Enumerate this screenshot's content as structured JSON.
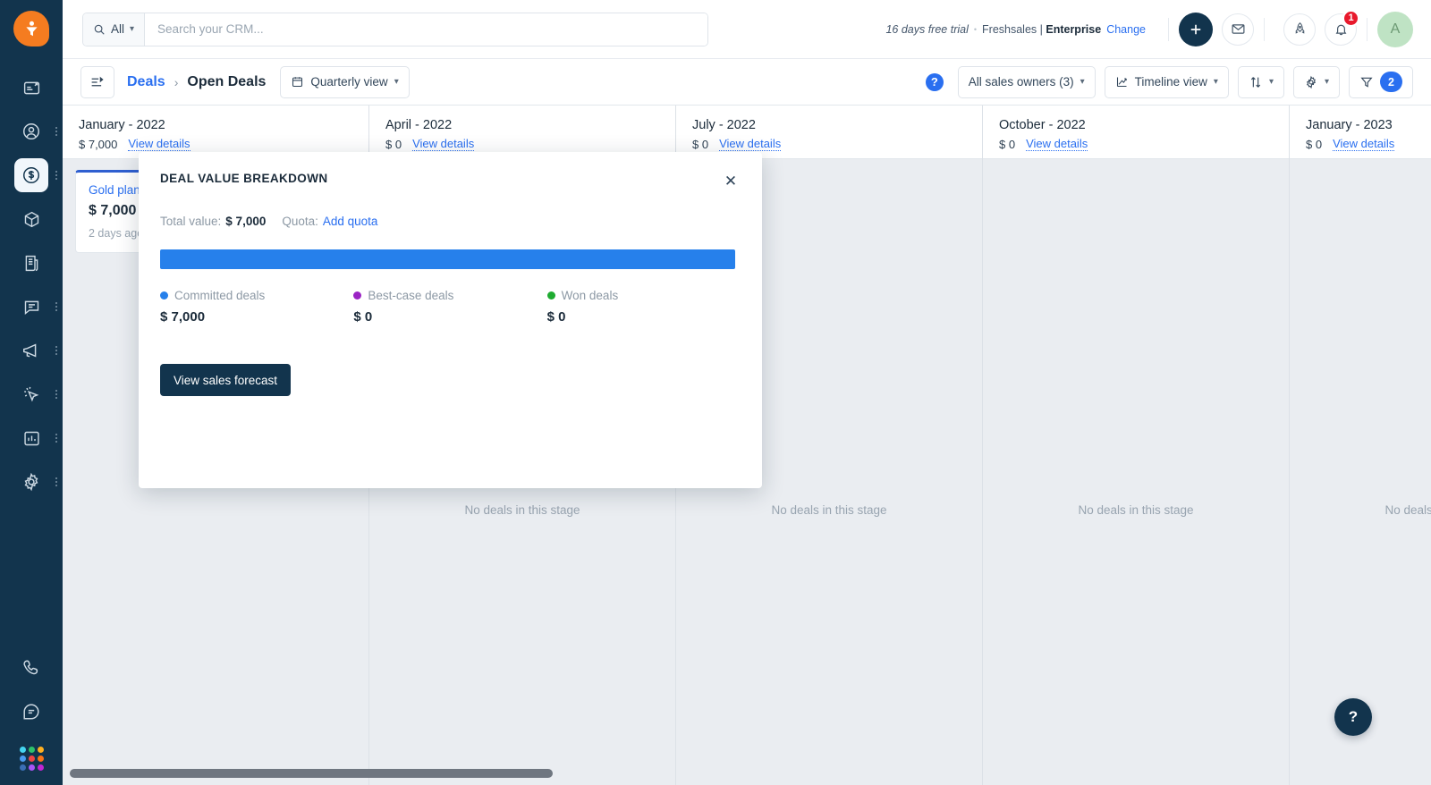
{
  "brand": {
    "logo_name": "freshsales-logo",
    "accent": "#f57c20"
  },
  "search": {
    "scope": "All",
    "placeholder": "Search your CRM...",
    "value": ""
  },
  "account": {
    "trial_days": "16 days free trial",
    "separator": "•",
    "product": "Freshsales | ",
    "plan": "Enterprise",
    "change_label": "Change",
    "notifications_count": "1",
    "avatar_initial": "A"
  },
  "toolbar": {
    "breadcrumb_parent": "Deals",
    "breadcrumb_sep": "›",
    "breadcrumb_current": "Open Deals",
    "period_view": "Quarterly view",
    "owners_filter": "All sales owners (3)",
    "display_view": "Timeline view",
    "filter_count": "2",
    "help_glyph": "?"
  },
  "board": {
    "columns": [
      {
        "title": "January - 2022",
        "amount": "$ 7,000",
        "details_label": "View details",
        "empty_label": "",
        "deals": [
          {
            "name": "Gold plan",
            "amount": "$ 7,000",
            "age": "2 days ago"
          }
        ]
      },
      {
        "title": "April - 2022",
        "amount": "$ 0",
        "details_label": "View details",
        "empty_label": "No deals in this stage",
        "deals": []
      },
      {
        "title": "July - 2022",
        "amount": "$ 0",
        "details_label": "View details",
        "empty_label": "No deals in this stage",
        "deals": []
      },
      {
        "title": "October - 2022",
        "amount": "$ 0",
        "details_label": "View details",
        "empty_label": "No deals in this stage",
        "deals": []
      },
      {
        "title": "January - 2023",
        "amount": "$ 0",
        "details_label": "View details",
        "empty_label": "No deals in this stage",
        "deals": []
      }
    ]
  },
  "modal": {
    "title": "DEAL VALUE BREAKDOWN",
    "close_glyph": "✕",
    "total_label": "Total value:",
    "total_value": "$ 7,000",
    "quota_label": "Quota:",
    "quota_link": "Add quota",
    "action_label": "View sales forecast",
    "chart_data": {
      "type": "bar",
      "title": "DEAL VALUE BREAKDOWN",
      "categories": [
        "Committed deals",
        "Best-case deals",
        "Won deals"
      ],
      "values": [
        7000,
        0,
        0
      ],
      "value_labels": [
        "$ 7,000",
        "$ 0",
        "$ 0"
      ],
      "colors": [
        "#2680eb",
        "#9b24c4",
        "#1fab31"
      ],
      "total": 7000,
      "total_label": "$ 7,000",
      "quota": null,
      "xlabel": "",
      "ylabel": "",
      "stacked": true,
      "orientation": "horizontal",
      "legend": "bottom",
      "grid": false
    }
  },
  "help_fab": {
    "glyph": "?"
  },
  "sidebar": {
    "items": [
      {
        "name": "dashboard",
        "has_menu": false
      },
      {
        "name": "contacts",
        "has_menu": true
      },
      {
        "name": "deals",
        "has_menu": true,
        "active": true
      },
      {
        "name": "products",
        "has_menu": false
      },
      {
        "name": "documents",
        "has_menu": false
      },
      {
        "name": "conversations",
        "has_menu": true
      },
      {
        "name": "campaigns",
        "has_menu": true
      },
      {
        "name": "automations",
        "has_menu": true
      },
      {
        "name": "reports",
        "has_menu": true
      },
      {
        "name": "settings",
        "has_menu": true
      }
    ],
    "bottom": [
      {
        "name": "phone"
      },
      {
        "name": "chat"
      }
    ],
    "app_switcher_colors": [
      "#45d4f0",
      "#2ec16a",
      "#ffb020",
      "#4a9bf0",
      "#ef4444",
      "#f97316",
      "#3b6fb5",
      "#a855f7",
      "#c026d3"
    ]
  }
}
